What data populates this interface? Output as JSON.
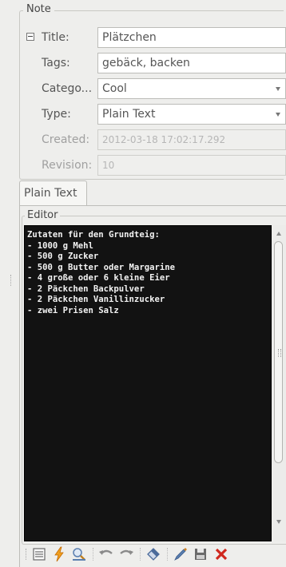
{
  "note_panel": {
    "title": "Note",
    "fields": {
      "title": {
        "label": "Title:",
        "value": "Plätzchen"
      },
      "tags": {
        "label": "Tags:",
        "value": "gebäck, backen"
      },
      "category": {
        "label": "Catego...",
        "value": "Cool"
      },
      "type": {
        "label": "Type:",
        "value": "Plain Text"
      },
      "created": {
        "label": "Created:",
        "value": "2012-03-18 17:02:17.292"
      },
      "revision": {
        "label": "Revision:",
        "value": "10"
      }
    }
  },
  "tabs": [
    {
      "label": "Plain Text",
      "active": true
    }
  ],
  "editor": {
    "title": "Editor",
    "content": "Zutaten für den Grundteig:\n- 1000 g Mehl\n- 500 g Zucker\n- 500 g Butter oder Margarine\n- 4 große oder 6 kleine Eier\n- 2 Päckchen Backpulver\n- 2 Päckchen Vanillinzucker\n- zwei Prisen Salz"
  },
  "toolbar": {
    "buttons": [
      "list-icon",
      "flash-icon",
      "zoom-icon",
      "undo-icon",
      "redo-icon",
      "eraser-icon",
      "pen-icon",
      "save-icon",
      "delete-icon"
    ]
  }
}
